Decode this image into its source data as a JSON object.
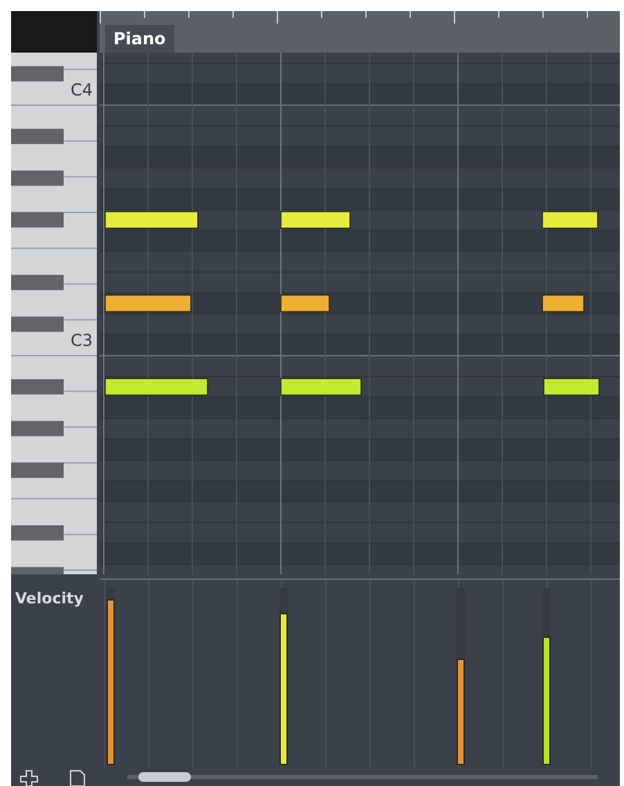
{
  "tab": {
    "label": "Piano",
    "selected": true
  },
  "keyboard": {
    "labels": [
      "C4",
      "C3"
    ]
  },
  "notes": [
    {
      "color": "#e6ec3c"
    },
    {
      "color": "#e6ec3c"
    },
    {
      "color": "#e6ec3c"
    },
    {
      "color": "#eeae32"
    },
    {
      "color": "#eeae32"
    },
    {
      "color": "#eeae32"
    },
    {
      "color": "#c2ea30"
    },
    {
      "color": "#c2ea30"
    },
    {
      "color": "#c2ea30"
    }
  ],
  "velocity": {
    "label": "Velocity",
    "bars": [
      {
        "level": 0.94,
        "color": "#e8923a"
      },
      {
        "level": 0.86,
        "color": "#e4ea3c"
      },
      {
        "level": 0.6,
        "color": "#e8923a"
      },
      {
        "level": 0.73,
        "color": "#b6e030"
      }
    ]
  }
}
